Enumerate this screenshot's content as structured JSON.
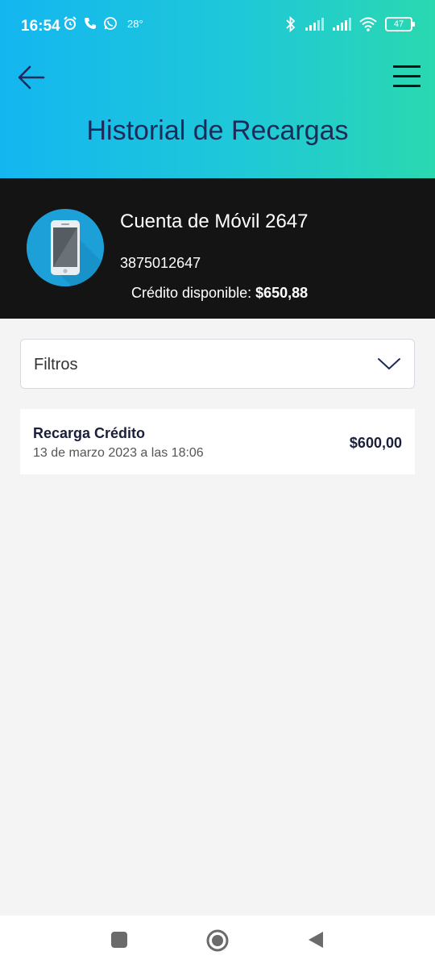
{
  "status_bar": {
    "time": "16:54",
    "temperature": "28°",
    "battery": "47"
  },
  "header": {
    "title": "Historial de Recargas"
  },
  "account": {
    "name": "Cuenta de Móvil 2647",
    "number": "3875012647",
    "credit_label": "Crédito disponible:",
    "credit_value": "$650,88"
  },
  "filters": {
    "label": "Filtros"
  },
  "recharges": [
    {
      "title": "Recarga Crédito",
      "date": "13 de marzo 2023 a las  18:06",
      "amount": "$600,00"
    }
  ],
  "colors": {
    "header_gradient_start": "#14b6f0",
    "header_gradient_end": "#2ad8b0",
    "title_text": "#1d2a5a",
    "account_bg": "#141414",
    "avatar_bg": "#1d9fd8"
  },
  "icons": [
    "back-arrow-icon",
    "menu-icon",
    "phone-icon",
    "chevron-down-icon",
    "alarm-icon",
    "call-icon",
    "whatsapp-icon",
    "bluetooth-icon",
    "signal-icon",
    "wifi-icon",
    "battery-icon"
  ]
}
